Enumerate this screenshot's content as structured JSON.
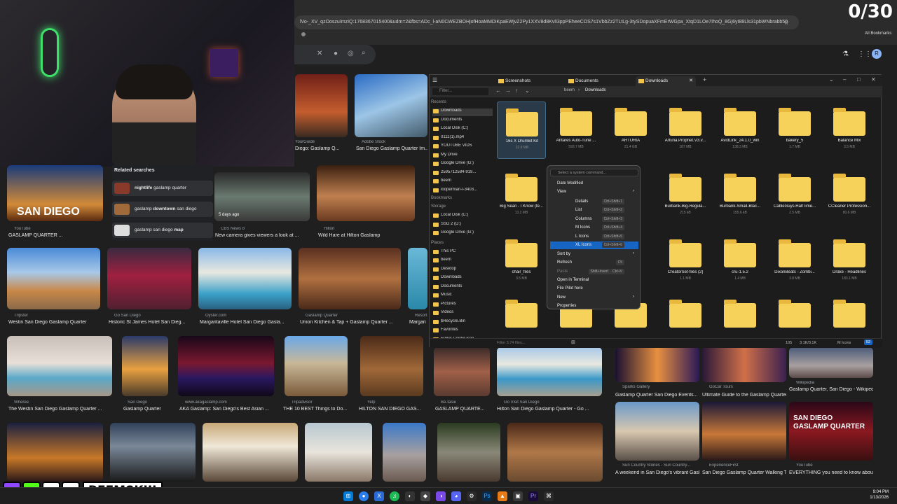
{
  "browser": {
    "url": "lVo-_XV_qzOoszu/mzIQ:1768367015400&udm=2&fbs=ADc_l-aN0CWEZBOHjofHoaMMDiKpaEWjvZ2Py1XXV8d8KvlI3ppPEheeCOS7s1VbbZz2TLtLg-3tySDopuaXFmErWGpa_XtqD1LOe7IhoQ_8Gj6yI88Lls31pbWNbrabb50",
    "bookmarks_label": "All Bookmarks",
    "counter": "0/30"
  },
  "images": {
    "row1": [
      {
        "src": "YourGuide",
        "caption": "Diego: Gaslamp Q..."
      },
      {
        "src": "Adobe Stock",
        "caption": "San Diego Gaslamp Quarter Im..."
      }
    ],
    "row2": [
      {
        "src": "YouTube",
        "caption": "GASLAMP QUARTER ...",
        "overlay": "SAN DIEGO"
      },
      {
        "src": "CBS News 8",
        "caption": "New camera gives viewers a look at ...",
        "badge": "5 days ago"
      },
      {
        "src": "Hilton",
        "caption": "Wild Hare at Hilton Gaslamp"
      }
    ],
    "row3": [
      {
        "src": "Tripster",
        "caption": "Westin San Diego Gaslamp Quarter"
      },
      {
        "src": "Go San Diego",
        "caption": "Historic St James Hotel San Dieg..."
      },
      {
        "src": "Oyster.com",
        "caption": "Margaritaville Hotel San Diego Gasla..."
      },
      {
        "src": "Gaslamp Quarter",
        "caption": "Union Kitchen & Tap + Gaslamp Quarter ..."
      },
      {
        "src": "Resort",
        "caption": "Margari"
      }
    ],
    "row4": [
      {
        "src": "Wheree",
        "caption": "The Westin San Diego Gaslamp Quarter ..."
      },
      {
        "src": "San Diego",
        "caption": "Gaslamp Quarter"
      },
      {
        "src": "www.akagaslamp.com",
        "caption": "AKA Gaslamp: San Diego's Best Asian ..."
      },
      {
        "src": "Tripadvisor",
        "caption": "THE 10 BEST Things to Do..."
      },
      {
        "src": "Yelp",
        "caption": "HILTON SAN DIEGO GAS..."
      },
      {
        "src": "Be-tasie",
        "caption": "GASLAMP QUARTE..."
      },
      {
        "src": "Go Visit San Diego",
        "caption": "Hilton San Diego Gaslamp Quarter - Go ..."
      },
      {
        "src": "Sparks Gallery",
        "caption": "Gaslamp Quarter San Diego Events..."
      },
      {
        "src": "GoCar Tours",
        "caption": "Ultimate Guide to the Gaslamp Quarter o..."
      },
      {
        "src": "Wikipedia",
        "caption": "Gaslamp Quarter, San Diego - Wikipedia"
      }
    ],
    "row5": [
      {
        "src": "Sun Country Stories - Sun Country...",
        "caption": "A weekend in San Diego's vibrant Gasla..."
      },
      {
        "src": "ExperienceFirst",
        "caption": "San Diego Gaslamp Quarter Walking Tou..."
      },
      {
        "src": "YouTube",
        "caption": "EVERYTHING you need to know about t...",
        "overlay": "SAN DIEGO GASLAMP QUARTER"
      }
    ]
  },
  "related": {
    "title": "Related searches",
    "items": [
      {
        "pre": "nightlife",
        "main": " gaslamp quarter"
      },
      {
        "pre": "gaslamp ",
        "main": "downtown",
        "post": " san diego"
      },
      {
        "pre": "gaslamp san diego ",
        "main": "map"
      }
    ]
  },
  "explorer": {
    "tabs": [
      "Screenshots",
      "Documents",
      "Downloads"
    ],
    "breadcrumb": [
      "beem",
      "Downloads"
    ],
    "nav_filter": "Filter...",
    "nav": {
      "recents_label": "Recents",
      "recents": [
        "Downloads",
        "Documents",
        "Local Disk (C:)",
        "0111(1).mp4",
        "YOUTUBE VIDS",
        "My Drive",
        "Google Drive (G:)",
        "2595712584-919...",
        "beem",
        "looperman-l-3403..."
      ],
      "bookmarks_label": "Bookmarks",
      "storage_label": "Storage",
      "storage": [
        "Local Disk (C:)",
        "SSD 2 (D:)",
        "Google Drive (G:)"
      ],
      "places_label": "Places",
      "places": [
        "This PC",
        "beem",
        "Desktop",
        "Downloads",
        "Documents",
        "Music",
        "Pictures",
        "Videos",
        "$Recycle.Bin",
        "Favorites",
        "FPilot-Config.json"
      ]
    },
    "folders": [
      {
        "name": "16s X Drumkit Kit",
        "size": "22.9 MB"
      },
      {
        "name": "Antares Auto-Tune ...",
        "size": "593.7 MB"
      },
      {
        "name": "ARTURIA",
        "size": "21.4 GB"
      },
      {
        "name": "Arturia.Prophet.V3.v...",
        "size": "187 MB"
      },
      {
        "name": "AvidLink_24.1.0_win",
        "size": "138.3 MB"
      },
      {
        "name": "bakery_5",
        "size": "1.7 MB"
      },
      {
        "name": "Balance Mix",
        "size": "3.5 MB"
      },
      {
        "name": "Big Sean - I Know (fe...",
        "size": "13.2 MB"
      },
      {
        "name": "Burbank-Big-Regula...",
        "size": "215 kB"
      },
      {
        "name": "Burbank-Small-Blac...",
        "size": "155.6 kB"
      },
      {
        "name": "CableGuys.HalfTime...",
        "size": "2.5 MB"
      },
      {
        "name": "CCleaner Profession...",
        "size": "80.6 MB"
      },
      {
        "name": "chair_files",
        "size": "3.5 MB"
      },
      {
        "name": "CreatorSet-files (2)",
        "size": "1.1 MB"
      },
      {
        "name": "cru-1.5.2",
        "size": "1.4 MB"
      },
      {
        "name": "DixonBeats - Zombi...",
        "size": "3.8 MB"
      },
      {
        "name": "Drake - Headlines",
        "size": "183.1 MB"
      }
    ],
    "status": {
      "filter": "Filter 3.74 files...",
      "count": "105",
      "size": "3.1K/3.1K",
      "view": "M Icons",
      "zoom": "52"
    }
  },
  "context_menu": {
    "search": "Select a system command...",
    "items": [
      {
        "label": "Date Modified"
      },
      {
        "label": "View"
      },
      {
        "label": "Details",
        "shortcut": "Ctrl+Shift+1"
      },
      {
        "label": "List",
        "shortcut": "Ctrl+Shift+2"
      },
      {
        "label": "Columns",
        "shortcut": "Ctrl+Shift+3"
      },
      {
        "label": "M Icons",
        "shortcut": "Ctrl+Shift+4"
      },
      {
        "label": "L Icons",
        "shortcut": "Ctrl+Shift+5"
      },
      {
        "label": "XL Icons",
        "shortcut": "Ctrl+Shift+6"
      },
      {
        "label": "Sort by"
      },
      {
        "label": "Refresh",
        "shortcut": "F5"
      },
      {
        "label": "Paste",
        "shortcut": "Ctrl+V"
      },
      {
        "label": "Open in Terminal"
      },
      {
        "label": "File Pilot here"
      },
      {
        "label": "New"
      },
      {
        "label": "Properties"
      }
    ],
    "paste_alt": "Shift+Insert"
  },
  "overlay": {
    "handle": "BEEMSKIII",
    "socials": [
      "twitch",
      "kick",
      "x",
      "instagram"
    ]
  },
  "taskbar": {
    "time": "9:04 PM",
    "date": "1/13/2026"
  }
}
